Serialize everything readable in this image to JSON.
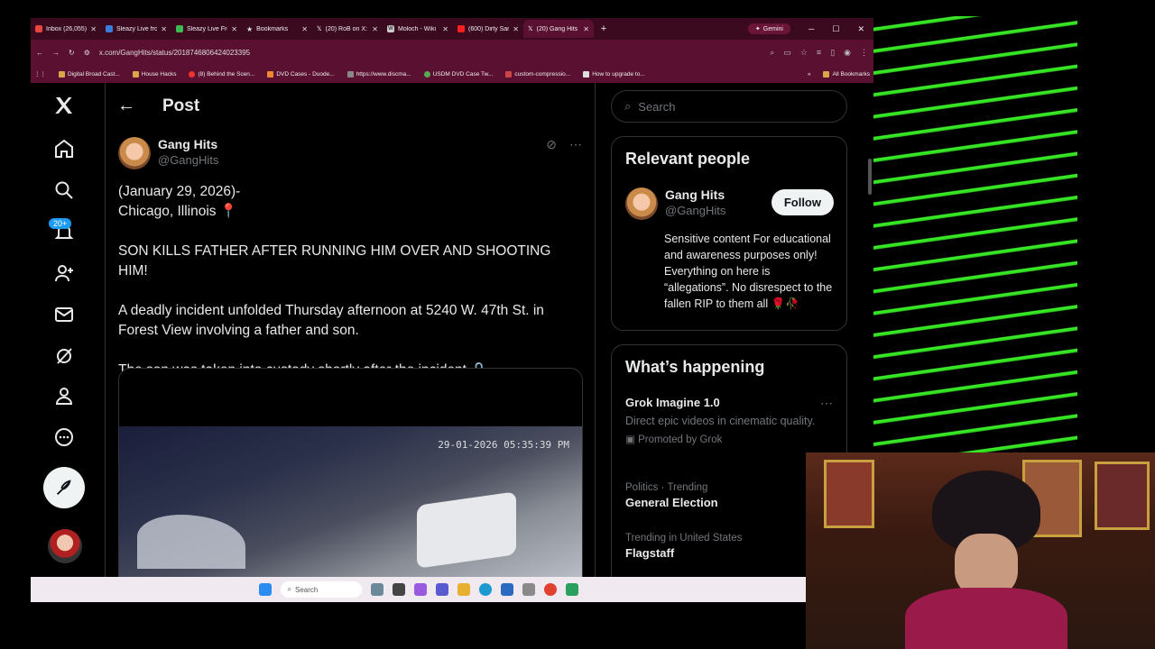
{
  "browser": {
    "tabs": [
      {
        "title": "Inbox (26,055)",
        "color": "#e8453c"
      },
      {
        "title": "Sleazy Live from",
        "color": "#3b7bdc"
      },
      {
        "title": "Sleazy Live From",
        "color": "#3cba54"
      },
      {
        "title": "Bookmarks",
        "color": "#bbbbbb"
      },
      {
        "title": "(20) RoB on X:",
        "color": "#ffffff"
      },
      {
        "title": "Moloch - Wiki",
        "color": "#cccccc"
      },
      {
        "title": "(600) Dirty San",
        "color": "#ff2020"
      },
      {
        "title": "(20) Gang Hits",
        "color": "#ffffff"
      }
    ],
    "new_tab": "+",
    "gemini_label": "Gemini",
    "url": "x.com/GangHits/status/2018746806424023395",
    "bookmarks": [
      "Digital Broad Cast...",
      "House Hacks",
      "(8) Behind the Scen...",
      "DVD Cases - Duode...",
      "https://www.discma...",
      "USDM DVD Case Tw...",
      "custom-compressio...",
      "How to upgrade to..."
    ],
    "bookmarks_more": "»",
    "all_bookmarks": "All Bookmarks"
  },
  "nav": {
    "notifications_badge": "20+"
  },
  "post": {
    "header_title": "Post",
    "author_name": "Gang Hits",
    "author_handle": "@GangHits",
    "text": "(January 29, 2026)-\nChicago, Illinois 📍\n\nSON KILLS FATHER AFTER RUNNING HIM OVER AND SHOOTING HIM!\n\nA deadly incident unfolded Thursday afternoon at 5240 W. 47th St. in Forest View involving a father and son.\n\nThe son was taken into custody shortly after the incident.🔒",
    "video_timestamp": "29-01-2026 05:35:39 PM"
  },
  "sidebar": {
    "search_placeholder": "Search",
    "relevant_title": "Relevant people",
    "person_name": "Gang Hits",
    "person_handle": "@GangHits",
    "follow_label": "Follow",
    "person_bio": "Sensitive content For educational and awareness purposes only! Everything on here is “allegations”. No disrespect to the fallen RIP to them all 🌹🥀",
    "happening_title": "What’s happening",
    "trends": [
      {
        "sub": "",
        "main": "Grok Imagine 1.0",
        "desc": "Direct epic videos in cinematic quality.",
        "promo": "Promoted by Grok"
      },
      {
        "sub": "Politics · Trending",
        "main": "General Election"
      },
      {
        "sub": "Trending in United States",
        "main": "Flagstaff"
      }
    ]
  },
  "taskbar": {
    "search_label": "Search"
  },
  "colors": {
    "x_blue": "#1d9bf0",
    "chrome_frame": "#5a1030",
    "stripe_green": "#3df02a"
  }
}
